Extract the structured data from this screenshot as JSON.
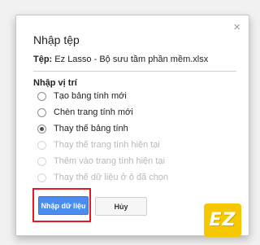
{
  "dialog": {
    "title": "Nhập tệp",
    "close_glyph": "×",
    "file_label": "Tệp:",
    "file_name": "Ez Lasso - Bộ sưu tầm phần mềm.xlsx",
    "section_label": "Nhập vị trí",
    "options": [
      {
        "label": "Tạo bảng tính mới",
        "checked": false,
        "disabled": false
      },
      {
        "label": "Chèn trang tính mới",
        "checked": false,
        "disabled": false
      },
      {
        "label": "Thay thế bảng tính",
        "checked": true,
        "disabled": false
      },
      {
        "label": "Thay thế trang tính hiện tại",
        "checked": false,
        "disabled": true
      },
      {
        "label": "Thêm vào trang tính hiện tại",
        "checked": false,
        "disabled": true
      },
      {
        "label": "Thay thế dữ liệu ở ô đã chọn",
        "checked": false,
        "disabled": true
      }
    ],
    "import_button": "Nhập dữ liệu",
    "cancel_button": "Hủy"
  },
  "logo": {
    "text": "EZ",
    "color": "#f5c800"
  },
  "colors": {
    "primary": "#4a8cf0",
    "highlight": "#e21b22"
  }
}
